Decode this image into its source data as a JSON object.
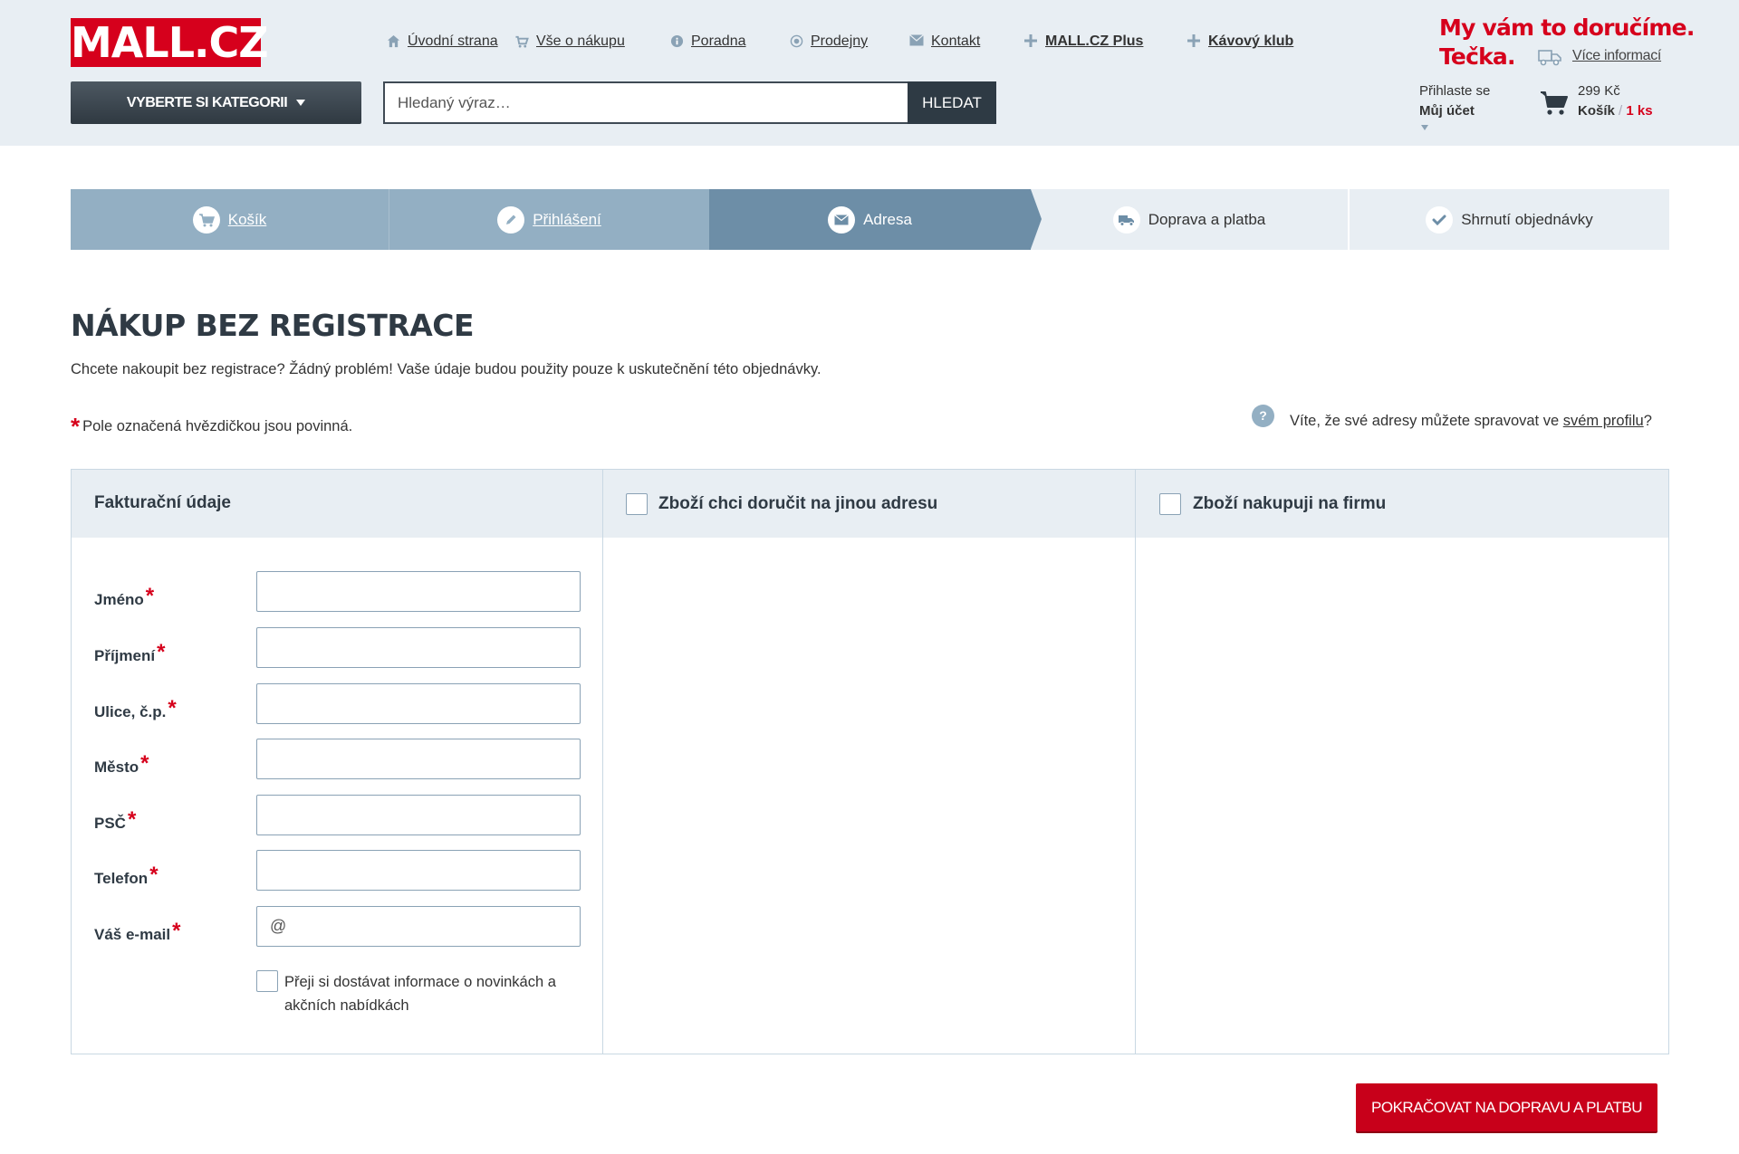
{
  "header": {
    "logo_text": "MALL.CZ",
    "category_button": "VYBERTE SI KATEGORII",
    "nav": [
      {
        "label": "Úvodní strana",
        "icon": "home-icon"
      },
      {
        "label": "Vše o nákupu",
        "icon": "cart-icon"
      },
      {
        "label": "Poradna",
        "icon": "info-icon"
      },
      {
        "label": "Prodejny",
        "icon": "location-icon"
      },
      {
        "label": "Kontakt",
        "icon": "mail-icon"
      },
      {
        "label": "MALL.CZ Plus",
        "icon": "plus-icon"
      },
      {
        "label": "Kávový klub",
        "icon": "plus-icon"
      }
    ],
    "search_placeholder": "Hledaný výraz…",
    "search_button": "HLEDAT",
    "slogan_line1": "My vám to doručíme.",
    "slogan_line2": "Tečka.",
    "more_info": "Více informací",
    "login_line1": "Přihlaste se",
    "login_line2": "Můj účet",
    "cart_price": "299 Kč",
    "cart_label": "Košík",
    "cart_separator": "/",
    "cart_qty": "1 ks"
  },
  "steps": [
    {
      "label": "Košík",
      "icon": "cart-icon",
      "state": "done"
    },
    {
      "label": "Přihlášení",
      "icon": "pencil-icon",
      "state": "done"
    },
    {
      "label": "Adresa",
      "icon": "envelope-icon",
      "state": "current"
    },
    {
      "label": "Doprava a platba",
      "icon": "truck-icon",
      "state": "future"
    },
    {
      "label": "Shrnutí objednávky",
      "icon": "check-icon",
      "state": "future"
    }
  ],
  "page": {
    "title": "NÁKUP BEZ REGISTRACE",
    "intro": "Chcete nakoupit bez registrace? Žádný problém! Vaše údaje budou použity pouze k uskutečnění této objednávky.",
    "required_star": "*",
    "required_note": "Pole označená hvězdičkou jsou povinná.",
    "help_icon_text": "?",
    "help_text_prefix": "Víte, že své adresy můžete spravovat ve ",
    "help_link": "svém profilu",
    "help_text_suffix": "?"
  },
  "form": {
    "col1_title": "Fakturační údaje",
    "col2_title": "Zboží chci doručit na jinou adresu",
    "col3_title": "Zboží nakupuji na firmu",
    "fields": [
      {
        "label": "Jméno",
        "value": ""
      },
      {
        "label": "Příjmení",
        "value": ""
      },
      {
        "label": "Ulice, č.p.",
        "value": ""
      },
      {
        "label": "Město",
        "value": ""
      },
      {
        "label": "PSČ",
        "value": ""
      },
      {
        "label": "Telefon",
        "value": ""
      },
      {
        "label": "Váš e-mail",
        "value": "@"
      }
    ],
    "newsletter": "Přeji si dostávat informace o novinkách a akčních nabídkách",
    "continue_button": "POKRAČOVAT NA DOPRAVU A PLATBU"
  },
  "colors": {
    "brand_red": "#d6001c",
    "header_bg": "#e8eef3",
    "step_done": "#93afc3",
    "step_current": "#6d8ea7",
    "dark": "#2f3a44"
  }
}
